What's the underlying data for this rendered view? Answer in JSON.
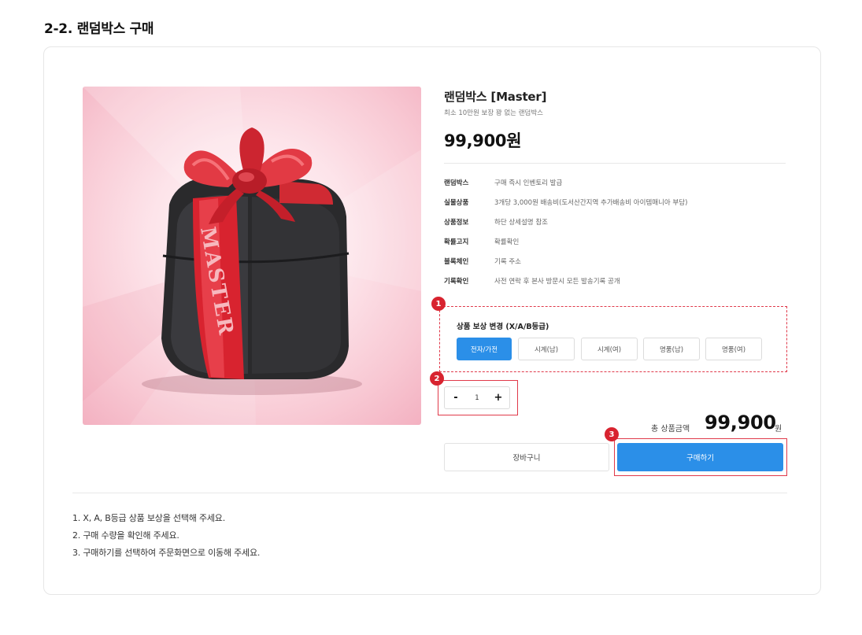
{
  "page_title": "2-2. 랜덤박스 구매",
  "product": {
    "name": "랜덤박스 [Master]",
    "subtitle": "최소 10만원 보장 꽝 없는 랜덤박스",
    "price": "99,900원",
    "image_label": "MASTER"
  },
  "specs": [
    {
      "key": "랜덤박스",
      "value": "구매 즉시 인벤토리 발급"
    },
    {
      "key": "실물상품",
      "value": "3개당 3,000원 배송비(도서산간지역 추가배송비 아이템매니아 부담)"
    },
    {
      "key": "상품정보",
      "value": "하단 상세설명 참조"
    },
    {
      "key": "확률고지",
      "value": "확률확인"
    },
    {
      "key": "블록체인",
      "value": "기록 주소"
    },
    {
      "key": "기록확인",
      "value": "사전 연락 후 본사 방문시 모든 발송기록 공개"
    }
  ],
  "options": {
    "title": "상품 보상 변경 (X/A/B등급)",
    "items": [
      {
        "label": "전자/가전",
        "selected": true
      },
      {
        "label": "시계(남)",
        "selected": false
      },
      {
        "label": "시계(여)",
        "selected": false
      },
      {
        "label": "명품(남)",
        "selected": false
      },
      {
        "label": "명품(여)",
        "selected": false
      }
    ]
  },
  "quantity": {
    "minus": "-",
    "value": "1",
    "plus": "+"
  },
  "total": {
    "label": "총 상품금액",
    "amount": "99,900",
    "unit": "원"
  },
  "buttons": {
    "cart": "장바구니",
    "buy": "구매하기"
  },
  "markers": [
    "1",
    "2",
    "3"
  ],
  "notes": [
    "1. X, A, B등급 상품 보상을 선택해 주세요.",
    "2. 구매 수량을 확인해 주세요.",
    "3. 구매하기를 선택하여 주문화면으로 이동해 주세요."
  ],
  "colors": {
    "accent_blue": "#2b8fe8",
    "highlight_red": "#e0394a",
    "marker_red": "#d8232f"
  }
}
